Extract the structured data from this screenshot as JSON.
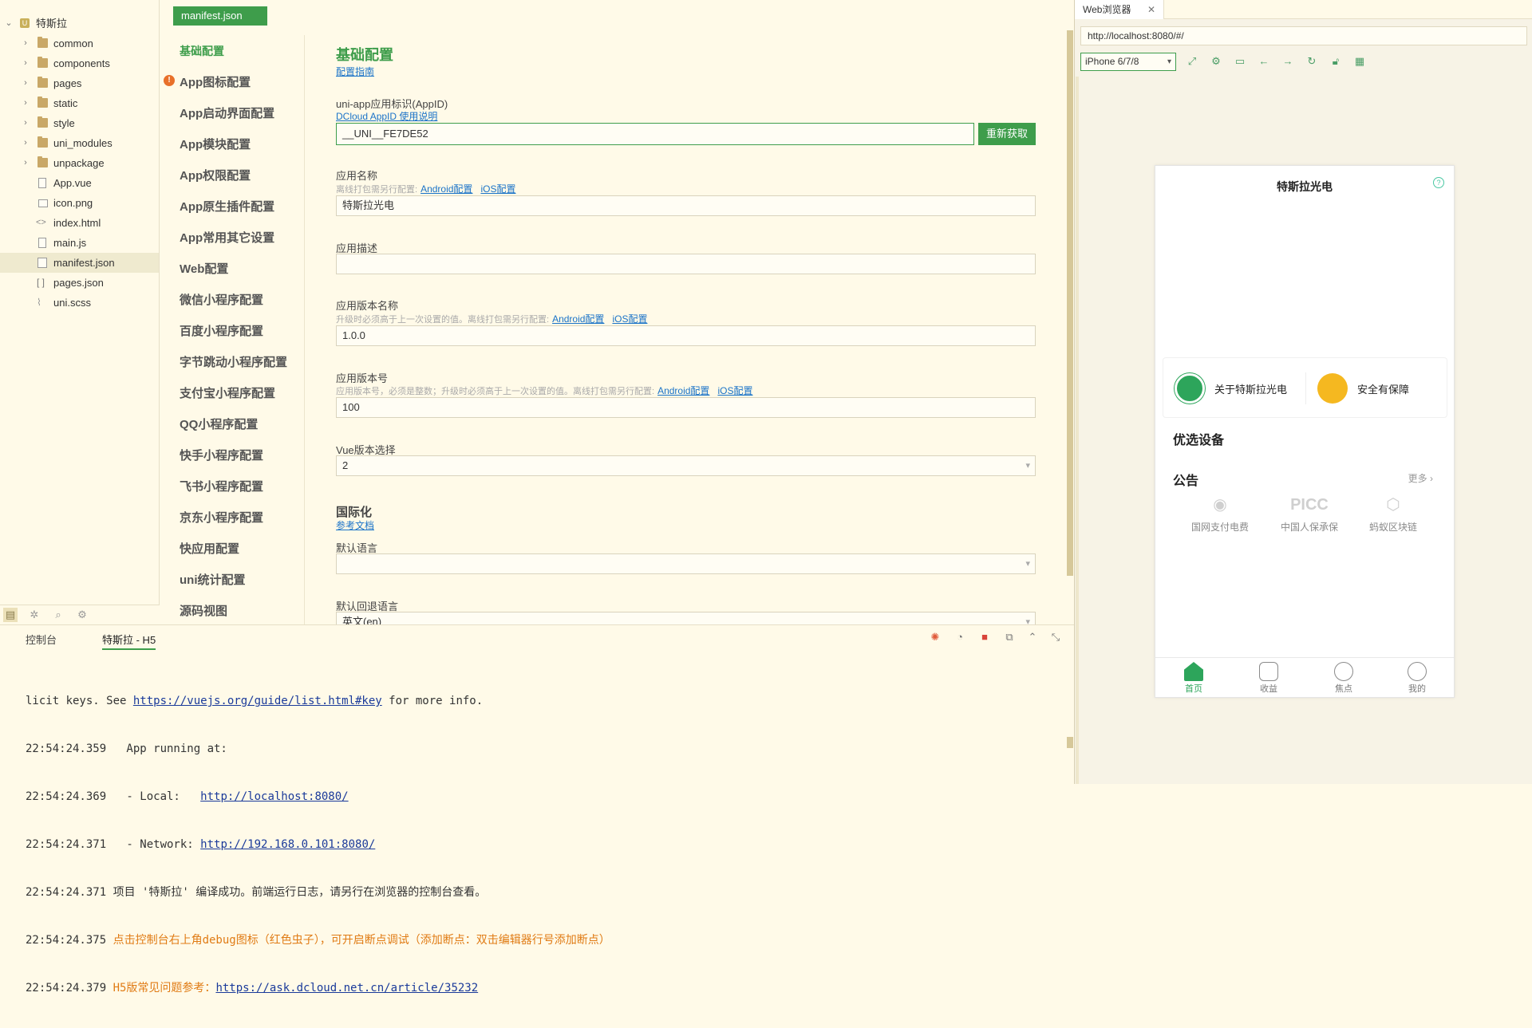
{
  "tree": {
    "project": "特斯拉",
    "items": [
      {
        "label": "common",
        "type": "folder"
      },
      {
        "label": "components",
        "type": "folder"
      },
      {
        "label": "pages",
        "type": "folder"
      },
      {
        "label": "static",
        "type": "folder"
      },
      {
        "label": "style",
        "type": "folder"
      },
      {
        "label": "uni_modules",
        "type": "folder"
      },
      {
        "label": "unpackage",
        "type": "folder"
      },
      {
        "label": "App.vue",
        "type": "file"
      },
      {
        "label": "icon.png",
        "type": "file"
      },
      {
        "label": "index.html",
        "type": "file"
      },
      {
        "label": "main.js",
        "type": "file"
      },
      {
        "label": "manifest.json",
        "type": "file"
      },
      {
        "label": "pages.json",
        "type": "file"
      },
      {
        "label": "uni.scss",
        "type": "file"
      }
    ],
    "selected": "manifest.json"
  },
  "editor": {
    "tab": "manifest.json",
    "nav": [
      "基础配置",
      "App图标配置",
      "App启动界面配置",
      "App模块配置",
      "App权限配置",
      "App原生插件配置",
      "App常用其它设置",
      "Web配置",
      "微信小程序配置",
      "百度小程序配置",
      "字节跳动小程序配置",
      "支付宝小程序配置",
      "QQ小程序配置",
      "快手小程序配置",
      "飞书小程序配置",
      "京东小程序配置",
      "快应用配置",
      "uni统计配置",
      "源码视图"
    ],
    "form": {
      "title": "基础配置",
      "guide_link": "配置指南",
      "appid_label": "uni-app应用标识(AppID)",
      "appid_help": "DCloud AppID 使用说明",
      "appid_value": "__UNI__FE7DE52",
      "reget_button": "重新获取",
      "name_label": "应用名称",
      "name_help": "离线打包需另行配置:",
      "android_link": "Android配置",
      "ios_link": "iOS配置",
      "name_value": "特斯拉光电",
      "desc_label": "应用描述",
      "desc_value": "",
      "version_name_label": "应用版本名称",
      "version_name_help": "升级时必须高于上一次设置的值。离线打包需另行配置:",
      "version_name_value": "1.0.0",
      "version_code_label": "应用版本号",
      "version_code_help": "应用版本号，必须是整数；升级时必须高于上一次设置的值。离线打包需另行配置:",
      "version_code_value": "100",
      "vue_label": "Vue版本选择",
      "vue_value": "2",
      "i18n_title": "国际化",
      "i18n_doc_link": "参考文档",
      "default_lang_label": "默认语言",
      "default_lang_value": "",
      "fallback_lang_label": "默认回退语言",
      "fallback_lang_value": "英文(en)"
    }
  },
  "console": {
    "tabs": [
      "控制台",
      "特斯拉 - H5"
    ],
    "active_tab": "特斯拉 - H5",
    "lines": [
      {
        "pre": "licit keys. See ",
        "link": "https://vuejs.org/guide/list.html#key",
        "post": " for more info.",
        "color": "normal"
      },
      {
        "pre": "22:54:24.359   App running at:",
        "link": "",
        "post": "",
        "color": "normal"
      },
      {
        "pre": "22:54:24.369   - Local:   ",
        "link": "http://localhost:8080/",
        "post": "",
        "color": "normal"
      },
      {
        "pre": "22:54:24.371   - Network: ",
        "link": "http://192.168.0.101:8080/",
        "post": "",
        "color": "normal"
      },
      {
        "pre": "22:54:24.371 项目 '特斯拉' 编译成功。前端运行日志，请另行在浏览器的控制台查看。",
        "link": "",
        "post": "",
        "color": "normal"
      },
      {
        "pre": "22:54:24.375 ",
        "orange": "点击控制台右上角debug图标（红色虫子），可开启断点调试（添加断点：双击编辑器行号添加断点）",
        "link": "",
        "post": "",
        "color": "mixed"
      },
      {
        "pre": "22:54:24.379 ",
        "orange": "H5版常见问题参考：",
        "link": "https://ask.dcloud.net.cn/article/35232",
        "post": "",
        "color": "mixed"
      }
    ]
  },
  "browser": {
    "tab": "Web浏览器",
    "url": "http://localhost:8080/#/",
    "device": "iPhone 6/7/8"
  },
  "phone": {
    "title": "特斯拉光电",
    "card_about": "关于特斯拉光电",
    "card_safe": "安全有保障",
    "section_devices": "优选设备",
    "section_notice": "公告",
    "more": "更多",
    "partners": [
      "国网支付电费",
      "中国人保承保",
      "蚂蚁区块链"
    ],
    "partner_logo_text": [
      "",
      "PICC",
      ""
    ],
    "tabs": [
      "首页",
      "收益",
      "焦点",
      "我的"
    ],
    "active_tab": "首页",
    "colors": {
      "brand_green": "#2da55b",
      "gold": "#f5b820"
    }
  }
}
